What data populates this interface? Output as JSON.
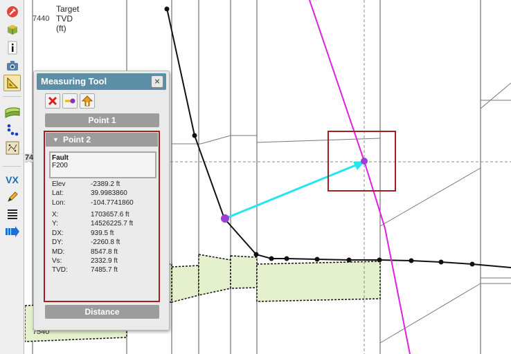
{
  "toolbar": {
    "buttons": [
      {
        "name": "settings-icon"
      },
      {
        "name": "cube-3d-icon"
      },
      {
        "name": "info-icon"
      },
      {
        "name": "camera-icon"
      },
      {
        "name": "measuring-tool-icon",
        "active": true
      },
      {
        "name": "horizon-icon"
      },
      {
        "name": "points-icon"
      },
      {
        "name": "scatter-icon"
      },
      {
        "name": "vx-icon"
      },
      {
        "name": "pencil-icon"
      },
      {
        "name": "list-icon"
      },
      {
        "name": "export-arrow-icon"
      }
    ],
    "vx_label": "VX"
  },
  "plot": {
    "axis_title": "Target TVD (ft)",
    "tick_top": "7440",
    "tick_bottom": "7540",
    "tick_partial": "74"
  },
  "measuring_tool": {
    "title": "Measuring Tool",
    "close_label": "×",
    "tools": [
      "delete-icon",
      "point-connect-icon",
      "home-arrow-icon"
    ],
    "point1_label": "Point 1",
    "point2_label": "Point 2",
    "distance_label": "Distance",
    "selected": {
      "type": "Fault",
      "name": "F200"
    },
    "properties": [
      {
        "key": "Elev",
        "value": "-2389.2 ft"
      },
      {
        "key": "Lat:",
        "value": "39.9983860"
      },
      {
        "key": "Lon:",
        "value": "-104.7741860"
      },
      {
        "key": "X:",
        "value": "1703657.6 ft"
      },
      {
        "key": "Y:",
        "value": "14526225.7 ft"
      },
      {
        "key": "DX:",
        "value": "939.5 ft"
      },
      {
        "key": "DY:",
        "value": "-2260.8 ft"
      },
      {
        "key": "MD:",
        "value": "8547.8 ft"
      },
      {
        "key": "Vs:",
        "value": "2332.9 ft"
      },
      {
        "key": "TVD:",
        "value": "7485.7 ft"
      }
    ]
  },
  "colors": {
    "fault_line": "#e020e0",
    "measure_arrow": "#22e6f0",
    "highlight": "#a31e22",
    "formation_fill": "#e4f1cc",
    "panel_header": "#5b8fa6",
    "point_marker": "#9b3fd6"
  }
}
